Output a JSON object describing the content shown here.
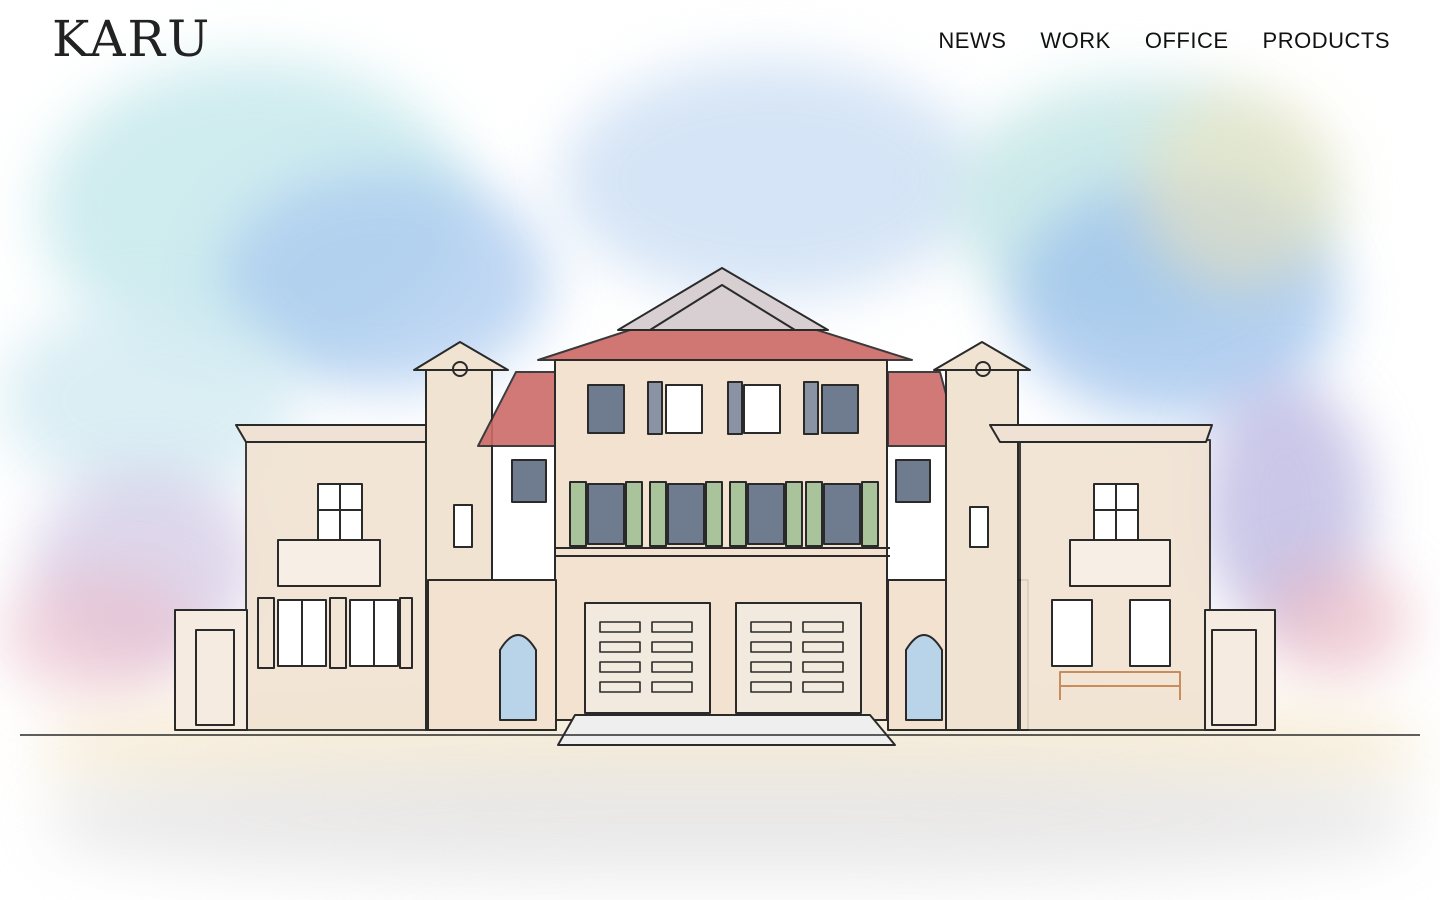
{
  "brand": {
    "logo_text": "KARU"
  },
  "nav": {
    "items": [
      {
        "label": "NEWS"
      },
      {
        "label": "WORK"
      },
      {
        "label": "OFFICE"
      },
      {
        "label": "PRODUCTS"
      }
    ]
  },
  "colors": {
    "roof": "#cd6b68",
    "wall": "#f1e3d2",
    "line": "#2a2a2a",
    "sky": "#a9c9ef"
  },
  "hero": {
    "image": "watercolor-house-illustration"
  }
}
